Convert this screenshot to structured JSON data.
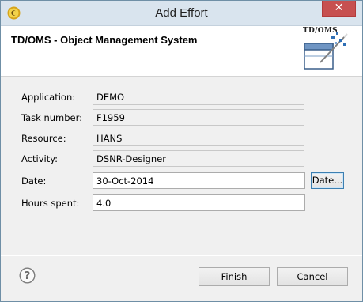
{
  "window": {
    "title": "Add Effort",
    "close_glyph": "✕"
  },
  "header": {
    "title": "TD/OMS - Object Management System",
    "logo_text": "TD/OMS"
  },
  "form": {
    "application": {
      "label": "Application:",
      "value": "DEMO"
    },
    "task_number": {
      "label": "Task number:",
      "value": "F1959"
    },
    "resource": {
      "label": "Resource:",
      "value": "HANS"
    },
    "activity": {
      "label": "Activity:",
      "value": "DSNR-Designer"
    },
    "date": {
      "label": "Date:",
      "value": "30-Oct-2014",
      "button_label": "Date..."
    },
    "hours_spent": {
      "label": "Hours spent:",
      "value": "4.0"
    }
  },
  "footer": {
    "finish_label": "Finish",
    "cancel_label": "Cancel",
    "help_glyph": "?"
  },
  "icons": {
    "app": "eclipse-app-icon",
    "close": "close-icon",
    "logo": "tdoms-logo",
    "help": "help-icon"
  },
  "colors": {
    "titlebar": "#d9e4ee",
    "close_button": "#c75050",
    "dialog_background": "#f0f0f0",
    "default_button_border": "#3c7fb1"
  }
}
